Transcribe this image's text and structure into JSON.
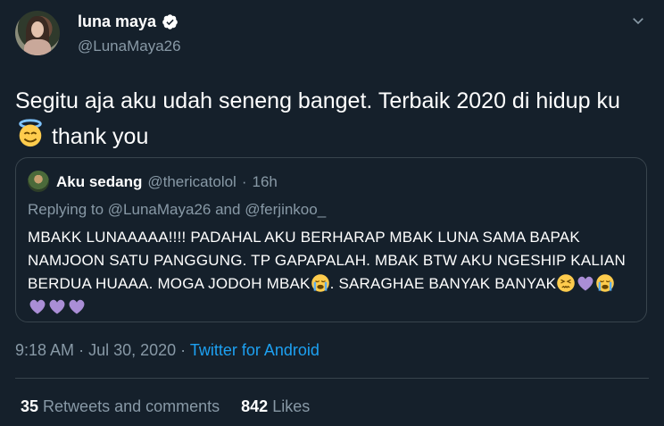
{
  "author": {
    "name": "luna maya",
    "handle": "@LunaMaya26"
  },
  "tweet": {
    "text_part1": "Segitu aja aku udah seneng banget. Terbaik 2020 di hidup ku",
    "text_part2": " thank you"
  },
  "quoted": {
    "name": "Aku sedang",
    "handle": "@thericatolol",
    "sep": "·",
    "time": "16h",
    "reply_prefix": "Replying to",
    "reply_mention1": "@LunaMaya26",
    "reply_and": "and",
    "reply_mention2": "@ferjinkoo_",
    "body_part1": "MBAKK LUNAAAAA!!!! PADAHAL AKU BERHARAP MBAK LUNA SAMA BAPAK NAMJOON SATU PANGGUNG. TP GAPAPALAH. MBAK BTW AKU NGESHIP KALIAN BERDUA HUAAA. MOGA JODOH MBAK",
    "body_part2": ". SARAGHAE BANYAK BANYAK"
  },
  "meta": {
    "time": "9:18 AM",
    "sep": "·",
    "date": "Jul 30, 2020",
    "source": "Twitter for Android"
  },
  "stats": {
    "retweets_count": "35",
    "retweets_label": "Retweets and comments",
    "likes_count": "842",
    "likes_label": "Likes"
  },
  "icons": {
    "verified": "verified-badge-icon",
    "more": "chevron-down-icon",
    "halo": "smiling-face-with-halo-emoji",
    "crying": "loudly-crying-face-emoji",
    "persevering": "persevering-face-emoji",
    "purple_heart": "purple-heart-emoji"
  },
  "colors": {
    "background": "#15202b",
    "muted": "#8899a6",
    "link": "#1da1f2",
    "border": "#38444d"
  }
}
